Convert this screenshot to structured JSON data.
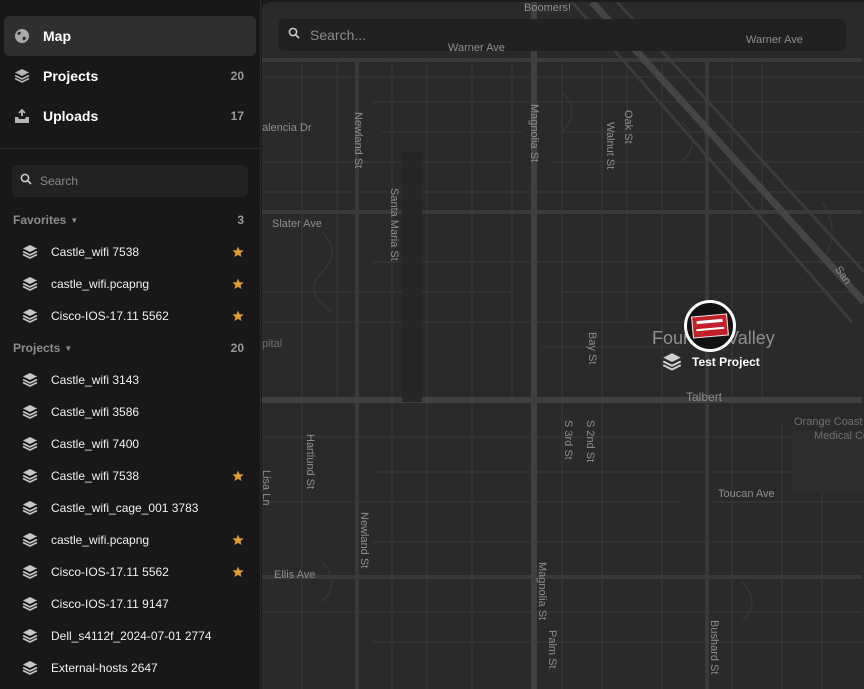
{
  "nav": [
    {
      "label": "Map",
      "count": "",
      "icon": "globe-icon",
      "active": true
    },
    {
      "label": "Projects",
      "count": "20",
      "icon": "layers-icon"
    },
    {
      "label": "Uploads",
      "count": "17",
      "icon": "inbox-upload-icon"
    }
  ],
  "sidebar_search": {
    "placeholder": "Search"
  },
  "favorites": {
    "title": "Favorites",
    "count": "3",
    "items": [
      {
        "label": "Castle_wifi 7538",
        "starred": true
      },
      {
        "label": "castle_wifi.pcapng",
        "starred": true
      },
      {
        "label": "Cisco-IOS-17.11 5562",
        "starred": true
      }
    ]
  },
  "projects": {
    "title": "Projects",
    "count": "20",
    "items": [
      {
        "label": "Castle_wifi 3143",
        "starred": false
      },
      {
        "label": "Castle_wifi 3586",
        "starred": false
      },
      {
        "label": "Castle_wifi 7400",
        "starred": false
      },
      {
        "label": "Castle_wifi 7538",
        "starred": true
      },
      {
        "label": "Castle_wifi_cage_001 3783",
        "starred": false
      },
      {
        "label": "castle_wifi.pcapng",
        "starred": true
      },
      {
        "label": "Cisco-IOS-17.11 5562",
        "starred": true
      },
      {
        "label": "Cisco-IOS-17.11 9147",
        "starred": false
      },
      {
        "label": "Dell_s4112f_2024-07-01 2774",
        "starred": false
      },
      {
        "label": "External-hosts 2647",
        "starred": false
      }
    ]
  },
  "map": {
    "search_placeholder": "Search...",
    "pin_label": "Test Project",
    "labels": {
      "boomers": "Boomers!",
      "warner_left": "Warner Ave",
      "warner_right": "Warner Ave",
      "valencia": "alencia Dr",
      "slater": "Slater Ave",
      "newland_top": "Newland St",
      "santa_maria": "Santa Maria St",
      "magnolia_top": "Magnolia St",
      "walnut": "Walnut St",
      "oak": "Oak St",
      "san": "San",
      "city": "Fountain Valley",
      "pital": "pital",
      "bay": "Bay St",
      "third": "S 3rd St",
      "second": "S 2nd St",
      "talbert": "Talbert",
      "orange_coast": "Orange Coast",
      "medical": "Medical Ce",
      "hartlund": "Hartlund St",
      "lisa": "Lisa Ln",
      "toucan": "Toucan Ave",
      "newland_bottom": "Newland St",
      "ellis": "Ellis Ave",
      "magnolia_bottom": "Magnolia St",
      "palm": "Palm St",
      "bushard": "Bushard St"
    }
  },
  "colors": {
    "star": "#e59a2a",
    "active_nav": "#2f2f2f",
    "map_bg": "#2a2a2a"
  }
}
